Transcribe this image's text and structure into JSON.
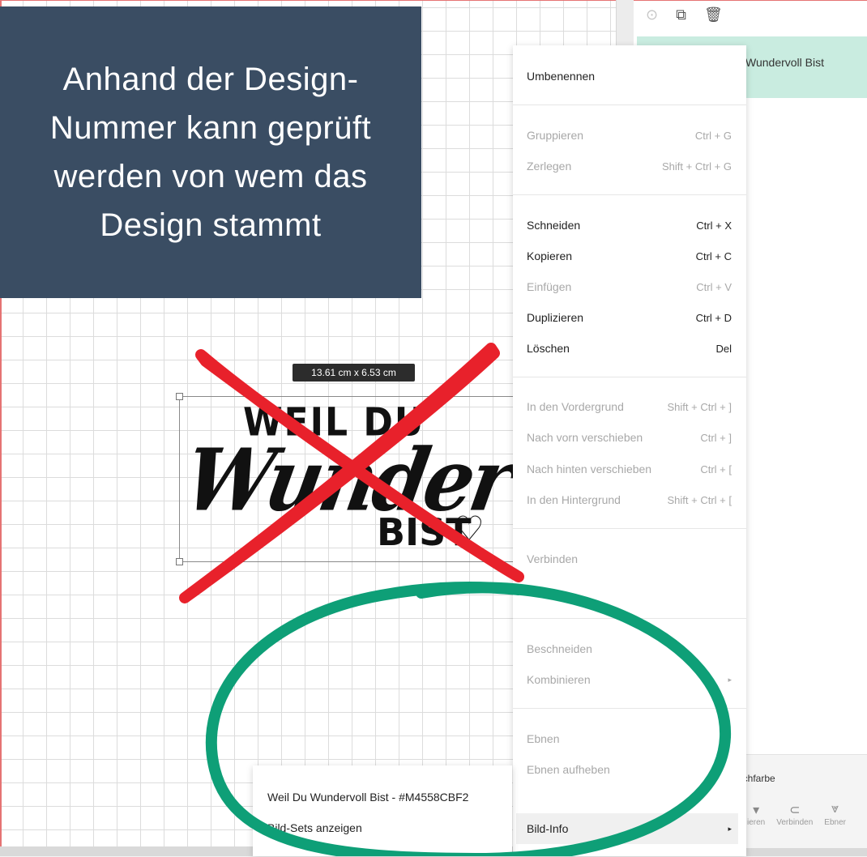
{
  "caption": {
    "text": "Anhand der Design-\nNummer kann geprüft\nwerden von wem das\nDesign stammt"
  },
  "canvas": {
    "dimension_badge": "13.61  cm x 6.53  cm",
    "design_text": {
      "line1": "WEIL DU",
      "line2": "Wundervoll",
      "line3": "BIST",
      "heart": "♡"
    }
  },
  "layers_panel": {
    "toolbar_icons": [
      "focus-icon",
      "duplicate-layer-icon",
      "trash-icon"
    ],
    "selected_layer": "Wundervoll Bist",
    "sub_label": "ichfarbe",
    "bottom_tools": [
      {
        "icon": "chevron-down-icon",
        "label": "ieren"
      },
      {
        "icon": "paperclip-icon",
        "label": "Verbinden"
      },
      {
        "icon": "flatten-icon",
        "label": "Ebner"
      }
    ]
  },
  "context_menu": {
    "items": [
      {
        "label": "Umbenennen",
        "shortcut": "",
        "enabled": true
      },
      {
        "label": "Gruppieren",
        "shortcut": "Ctrl + G",
        "enabled": false
      },
      {
        "label": "Zerlegen",
        "shortcut": "Shift + Ctrl + G",
        "enabled": false
      },
      {
        "label": "Schneiden",
        "shortcut": "Ctrl + X",
        "enabled": true
      },
      {
        "label": "Kopieren",
        "shortcut": "Ctrl + C",
        "enabled": true
      },
      {
        "label": "Einfügen",
        "shortcut": "Ctrl + V",
        "enabled": false
      },
      {
        "label": "Duplizieren",
        "shortcut": "Ctrl + D",
        "enabled": true
      },
      {
        "label": "Löschen",
        "shortcut": "Del",
        "enabled": true
      },
      {
        "label": "In den Vordergrund",
        "shortcut": "Shift + Ctrl + ]",
        "enabled": false
      },
      {
        "label": "Nach vorn verschieben",
        "shortcut": "Ctrl + ]",
        "enabled": false
      },
      {
        "label": "Nach hinten verschieben",
        "shortcut": "Ctrl + [",
        "enabled": false
      },
      {
        "label": "In den Hintergrund",
        "shortcut": "Shift + Ctrl + [",
        "enabled": false
      },
      {
        "label": "Verbinden",
        "shortcut": "",
        "enabled": false
      },
      {
        "label": "Beschneiden",
        "shortcut": "",
        "enabled": false
      },
      {
        "label": "Kombinieren",
        "shortcut": "▸",
        "enabled": false
      },
      {
        "label": "Ebnen",
        "shortcut": "",
        "enabled": false
      },
      {
        "label": "Ebnen aufheben",
        "shortcut": "",
        "enabled": false
      },
      {
        "label": "Bild-Info",
        "shortcut": "▸",
        "enabled": true
      }
    ]
  },
  "submenu": {
    "design_number": "Weil Du Wundervoll Bist - #M4558CBF2",
    "show_sets": "Bild-Sets anzeigen",
    "more_icon": "⌄"
  },
  "annotation_colors": {
    "cross": "#e8212b",
    "circle": "#0e9f77",
    "caption_bg": "#3a4d63"
  }
}
